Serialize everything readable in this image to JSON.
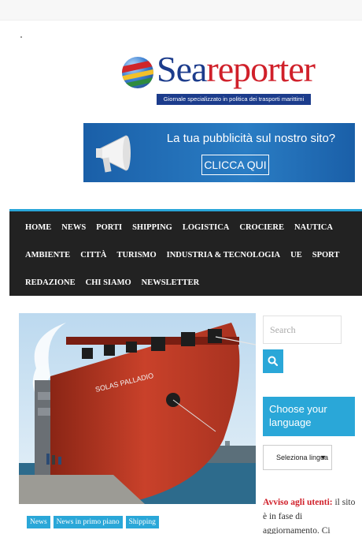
{
  "header": {
    "logo_sea": "Sea",
    "logo_reporter": "reporter",
    "tagline": "Giornale specializzato in politica dei trasporti marittimi"
  },
  "ad_banner": {
    "text": "La tua pubblicità sul nostro sito?",
    "button": "CLICCA QUI"
  },
  "nav": {
    "row1": [
      "HOME",
      "NEWS",
      "PORTI",
      "SHIPPING",
      "LOGISTICA",
      "CROCIERE",
      "NAUTICA"
    ],
    "row2": [
      "AMBIENTE",
      "CITTÀ",
      "TURISMO",
      "INDUSTRIA & TECNOLOGIA",
      "UE",
      "SPORT"
    ],
    "row3": [
      "REDAZIONE",
      "CHI SIAMO",
      "NEWSLETTER"
    ]
  },
  "article": {
    "ship_name": "SOLAS PALLADIO",
    "tags": [
      "News",
      "News in primo piano",
      "Shipping"
    ]
  },
  "sidebar": {
    "search_placeholder": "Search",
    "language_title": "Choose your language",
    "language_select": "Seleziona lingua",
    "notice_bold": "Avviso agli utenti:",
    "notice_text": " il sito è in fase di aggiornamento. Ci scusiamo per eventuali"
  },
  "colors": {
    "accent": "#2aa7d8",
    "nav_bg": "#222222",
    "logo_blue": "#1c3c8c",
    "logo_red": "#d0202a"
  },
  "icons": {
    "search": "magnifier-icon",
    "select": "chevron-down-icon",
    "ad": "megaphone-icon"
  }
}
